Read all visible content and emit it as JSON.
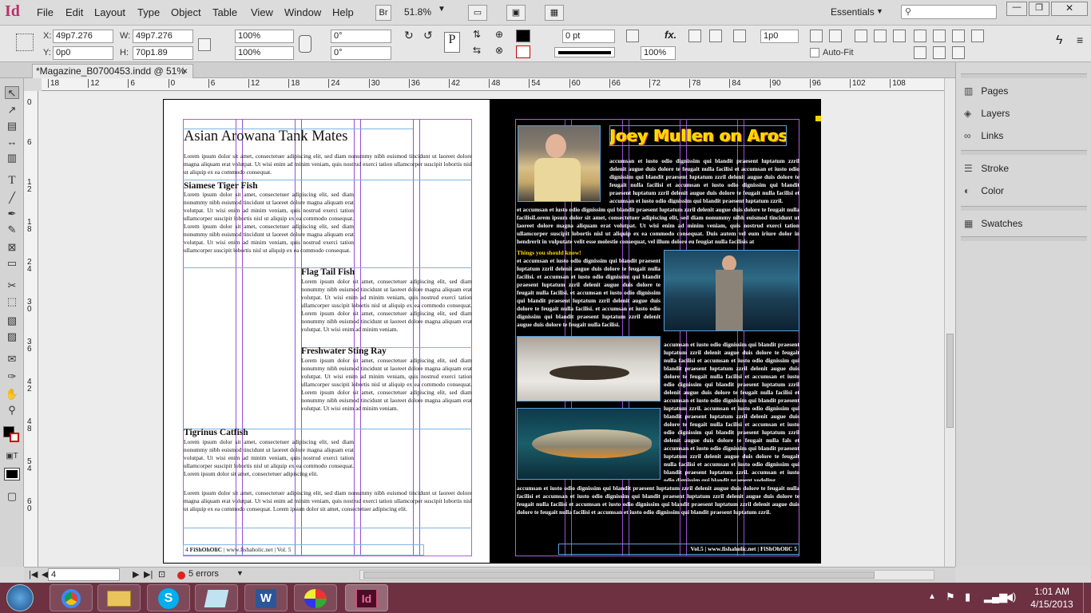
{
  "app": {
    "icon": "Id",
    "menu": [
      "File",
      "Edit",
      "Layout",
      "Type",
      "Object",
      "Table",
      "View",
      "Window",
      "Help"
    ],
    "bridge": "Br",
    "zoom": "51.8%",
    "workspace": "Essentials",
    "search_placeholder": ""
  },
  "control": {
    "x_label": "X:",
    "x": "49p7.276",
    "y_label": "Y:",
    "y": "0p0",
    "w_label": "W:",
    "w": "49p7.276",
    "h_label": "H:",
    "h": "70p1.89",
    "scale_x": "100%",
    "scale_y": "100%",
    "angle": "0°",
    "shear": "0°",
    "stroke_weight": "0 pt",
    "opacity": "100%",
    "gap": "1p0",
    "autofit": "Auto-Fit"
  },
  "tab": {
    "title": "*Magazine_B0700453.indd @ 51%",
    "close": "×"
  },
  "ruler": {
    "top": [
      "18",
      "12",
      "6",
      "0",
      "6",
      "12",
      "18",
      "24",
      "30",
      "36",
      "42",
      "48",
      "54",
      "60",
      "66",
      "72",
      "78",
      "84",
      "90",
      "96",
      "102",
      "108"
    ],
    "left": [
      "0",
      "6",
      "1 2",
      "1 8",
      "2 4",
      "3 0",
      "3 6",
      "4 2",
      "4 8",
      "5 4",
      "6 0"
    ]
  },
  "left_page": {
    "title": "Asian Arowana Tank Mates",
    "intro": "Lorem ipsum dolor sit amet, consectetuer adipiscing elit, sed diam nonummy nibh euismod tincidunt ut laoreet dolore magna aliquam erat volutpat. Ut wisi enim ad minim veniam, quis nostrud exerci tation ullamcorper suscipit lobortis nisl ut aliquip ex ea commodo consequat.",
    "sections": [
      {
        "heading": "Siamese Tiger Fish",
        "body": "Lorem ipsum dolor sit amet, consectetuer adipiscing elit, sed diam nonummy nibh euismod tincidunt ut laoreet dolore magna aliquam erat volutpat. Ut wisi enim ad minim veniam, quis nostrud exerci tation ullamcorper suscipit lobortis nisl ut aliquip ex ea commodo consequat. Lorem ipsum dolor sit amet, consectetuer adipiscing elit, sed diam nonummy nibh euismod tincidunt ut laoreet dolore magna aliquam erat volutpat. Ut wisi enim ad minim veniam, quis nostrud exerci tation ullamcorper suscipit lobortis nisl ut aliquip ex ea commodo consequat."
      },
      {
        "heading": "Flag Tail Fish",
        "body": "Lorem ipsum dolor sit amet, consectetuer adipiscing elit, sed diam nonummy nibh euismod tincidunt ut laoreet dolore magna aliquam erat volutpat. Ut wisi enim ad minim veniam, quis nostrud exerci tation ullamcorper suscipit lobortis nisl ut aliquip ex ea commodo consequat. Lorem ipsum dolor sit amet, consectetuer adipiscing elit, sed diam nonummy nibh euismod tincidunt ut laoreet dolore magna aliquam erat volutpat. Ut wisi enim ad minim veniam."
      },
      {
        "heading": "Freshwater Sting Ray",
        "body": "Lorem ipsum dolor sit amet, consectetuer adipiscing elit, sed diam nonummy nibh euismod tincidunt ut laoreet dolore magna aliquam erat volutpat. Ut wisi enim ad minim veniam, quis nostrud exerci tation ullamcorper suscipit lobortis nisl ut aliquip ex ea commodo consequat. Lorem ipsum dolor sit amet, consectetuer adipiscing elit, sed diam nonummy nibh euismod tincidunt ut laoreet dolore magna aliquam erat volutpat. Ut wisi enim ad minim veniam."
      },
      {
        "heading": "Tigrinus Catfish",
        "body": "Lorem ipsum dolor sit amet, consectetuer adipiscing elit, sed diam nonummy nibh euismod tincidunt ut laoreet dolore magna aliquam erat volutpat. Ut wisi enim ad minim veniam, quis nostrud exerci tation ullamcorper suscipit lobortis nisl ut aliquip ex ea commodo consequat. Lorem ipsum dolor sit amet, consectetuer adipiscing elit."
      }
    ],
    "outro": "Lorem ipsum dolor sit amet, consectetuer adipiscing elit, sed diam nonummy nibh euismod tincidunt ut laoreet dolore magna aliquam erat volutpat. Ut wisi enim ad minim veniam, quis nostrud exerci tation ullamcorper suscipit lobortis nisl ut aliquip ex ea commodo consequat. Lorem ipsum dolor sit amet, consectetuer adipiscing elit.",
    "footer_page": "4",
    "footer_brand": "FiShOhOliC",
    "footer_text": "| www.fishaholic.net | Vol. 5"
  },
  "right_page": {
    "title": "Joey Mullen on Aros",
    "col_text": "accumsan et iusto odio dignissim qui blandit praesent luptatum zzril delenit augue duis dolore te feugait nulla facilisi et accumsan et iusto odio dignissim qui blandit praesent luptatum zzril delenit augue duis dolore te feugait nulla facilisi et accumsan et iusto odio dignissim qui blandit praesent luptatum zzril delenit augue duis dolore te feugait nulla facilisi et accumsan et iusto odio dignissim qui blandit praesent luptatum zzril.",
    "wide_text": "et accumsan et iusto odio dignissim qui blandit praesent luptatum zzril delenit augue duis dolore te feugait nulla facilisiLorem ipsum dolor sit amet, consectetuer adipiscing elit, sed diam nonummy nibh euismod tincidunt ut laoreet dolore magna aliquam erat volutpat. Ut wisi enim ad minim veniam, quis nostrud exerci tation ullamcorper suscipit lobortis nisl ut aliquip ex ea commodo consequat. Duis autem vel eum iriure dolor in hendrerit in vulputate velit esse molestie consequat, vel illum dolore eu feugiat nulla facilisis at",
    "sidebar_heading": "Things you should know!",
    "sidebar_text": "et accumsan et iusto odio dignissim qui blandit praesent luptatum zzril delenit augue duis dolore te feugait nulla facilisi. et accumsan et iusto odio dignissim qui blandit praesent luptatum zzril delenit augue duis dolore te feugait nulla facilisi. et accumsan et iusto odio dignissim qui blandit praesent luptatum zzril delenit augue duis dolore te feugait nulla facilisi. et accumsan et iusto odio dignissim qui blandit praesent luptatum zzril delenit augue duis dolore te feugait nulla facilisi.",
    "right_col": "accumsan et iusto odio dignissim qui blandit praesent luptatum zzril delenit augue duis dolore te feugait nulla facilisi et accumsan et iusto odio dignissim qui blandit praesent luptatum zzril delenit augue duis dolore te feugait nulla facilisi et accumsan et iusto odio dignissim qui blandit praesent luptatum zzril delenit augue duis dolore te feugait nulla facilisi et accumsan et iusto odio dignissim qui blandit praesent luptatum zzril. accumsan et iusto odio dignissim qui blandit praesent luptatum zzril delenit augue duis dolore te feugait nulla facilisi et accumsan et iusto odio dignissim qui blandit praesent luptatum zzril delenit augue duis dolore te feugait nulla fals et accumsan et iusto odio dignissim qui blandit praesent luptatum zzril delenit augue duis dolore te feugait nulla facilisi et accumsan et iusto odio dignissim qui blandit praesent luptatum zzril. accumsan et iusto odio dignissim qui blandit praesent yodoling.",
    "bottom_text": "accumsan et iusto odio dignissim qui blandit praesent luptatum zzril delenit augue duis dolore te feugait nulla facilisi et accumsan et iusto odio dignissim qui blandit praesent luptatum zzril delenit augue duis dolore te feugait nulla facilisi et accumsan et iusto odio dignissim qui blandit praesent luptatum zzril delenit augue duis dolore te feugait nulla facilisi et accumsan et iusto odio dignissim qui blandit praesent luptatum zzril.",
    "footer_text": "Vol.5 | www.fishaholic.net |",
    "footer_brand": "FiShOhOliC",
    "footer_page": "5"
  },
  "panels": [
    {
      "label": "Pages",
      "icon": "pages-icon"
    },
    {
      "label": "Layers",
      "icon": "layers-icon"
    },
    {
      "label": "Links",
      "icon": "links-icon"
    },
    {
      "label": "Stroke",
      "icon": "stroke-icon"
    },
    {
      "label": "Color",
      "icon": "color-icon"
    },
    {
      "label": "Swatches",
      "icon": "swatches-icon"
    }
  ],
  "status": {
    "page": "4",
    "errors": "5 errors"
  },
  "clock": {
    "time": "1:01 AM",
    "date": "4/15/2013"
  },
  "colors": {
    "accent": "#b8316a",
    "taskbar": "#6d3142",
    "guide": "#9a4fd1",
    "title_yellow": "#ffd400"
  }
}
